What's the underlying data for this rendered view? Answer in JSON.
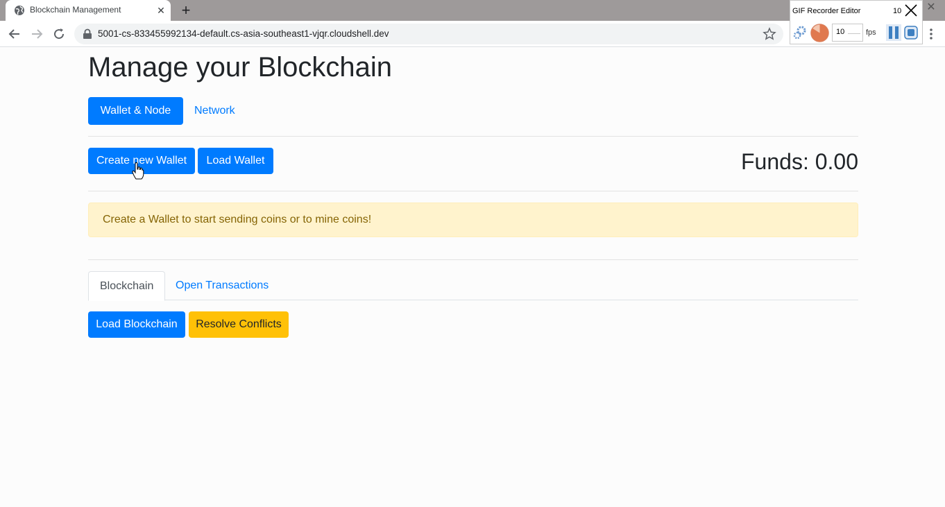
{
  "browser": {
    "tab_title": "Blockchain Management",
    "tab_close": "✕",
    "new_tab": "+",
    "url": "5001-cs-833455992134-default.cs-asia-southeast1-vjqr.cloudshell.dev"
  },
  "extension": {
    "title": "GIF Recorder Editor",
    "count": "10",
    "fps_value": "10",
    "fps_label": "fps"
  },
  "page": {
    "heading": "Manage your Blockchain",
    "nav": {
      "wallet_node": "Wallet & Node",
      "network": "Network"
    },
    "wallet": {
      "create_label": "Create new Wallet",
      "load_label": "Load Wallet",
      "funds": "Funds: 0.00"
    },
    "alert": "Create a Wallet to start sending coins or to mine coins!",
    "tabs": {
      "blockchain": "Blockchain",
      "open_transactions": "Open Transactions"
    },
    "actions": {
      "load_blockchain": "Load Blockchain",
      "resolve_conflicts": "Resolve Conflicts"
    }
  },
  "colors": {
    "primary": "#007bff",
    "warning": "#ffc107",
    "alert_bg": "#fff3cd",
    "alert_text": "#856404"
  }
}
